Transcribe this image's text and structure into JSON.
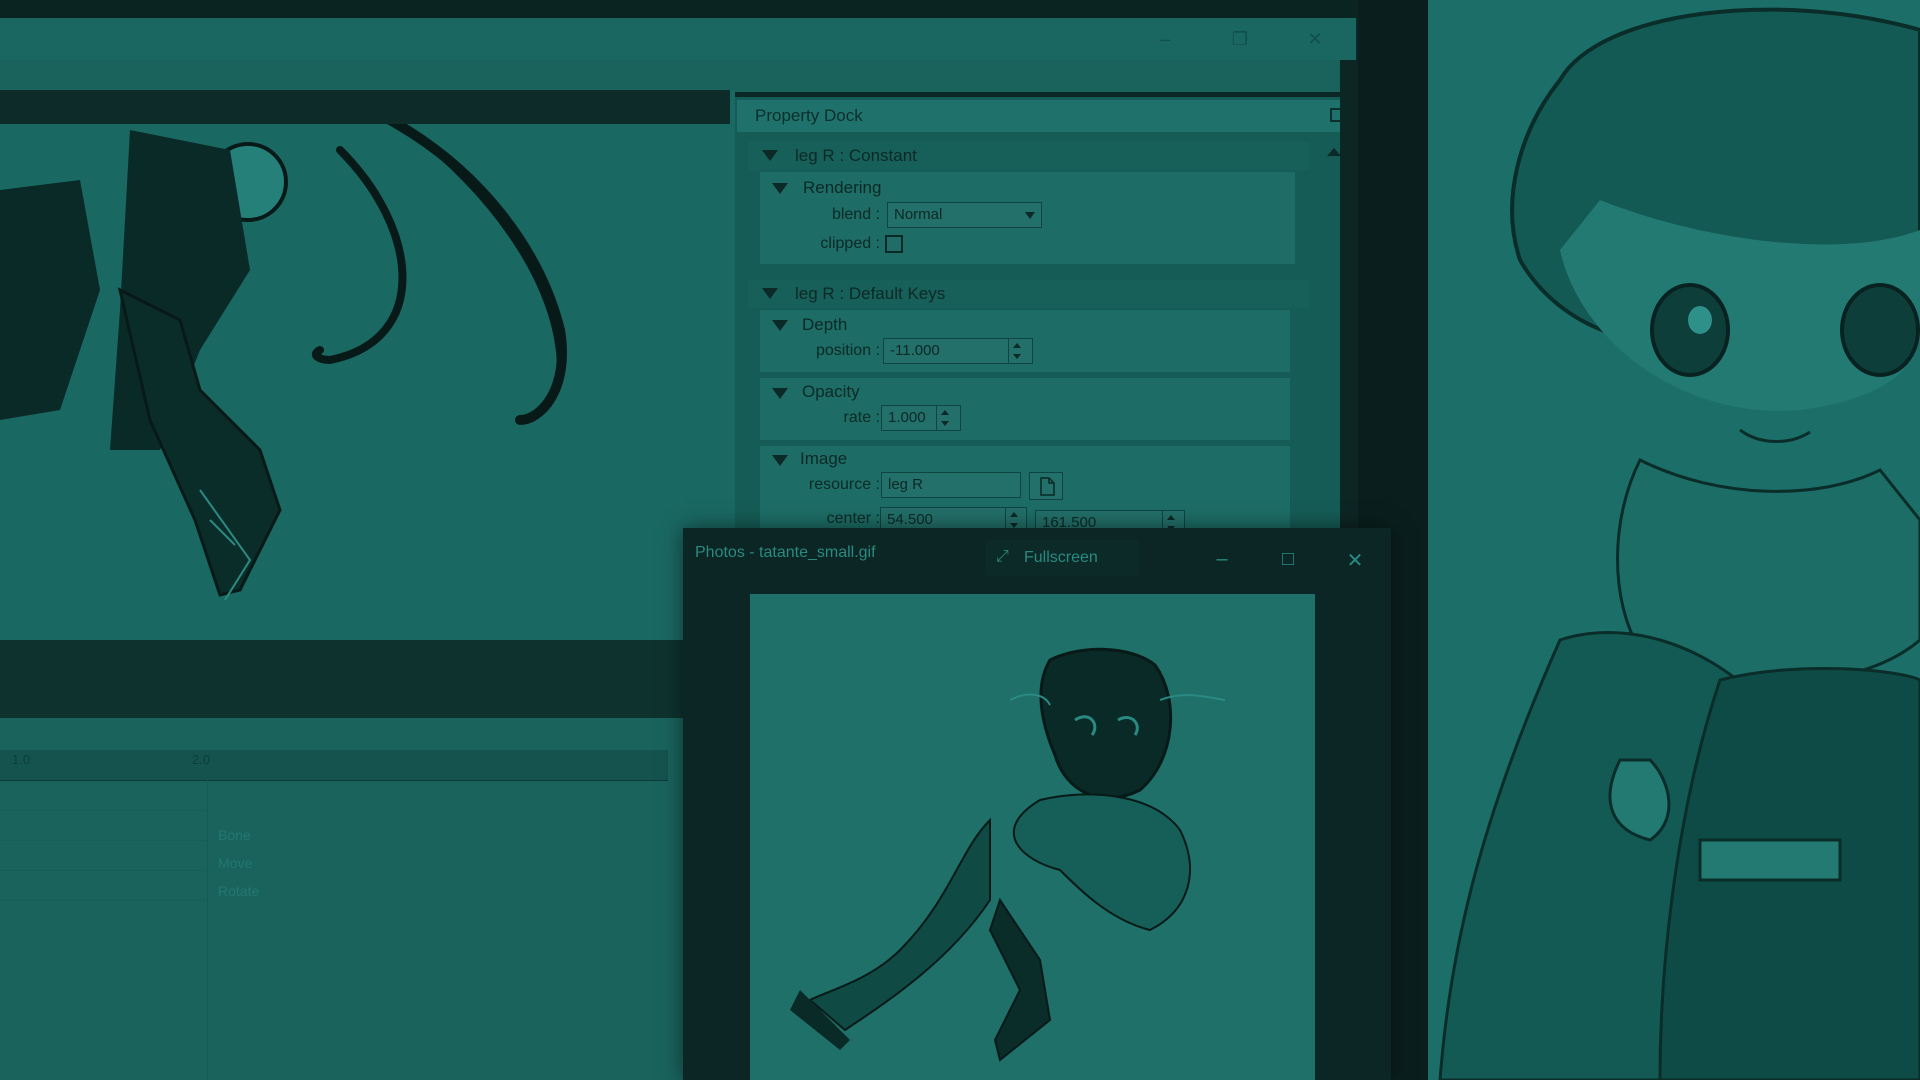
{
  "main_window": {
    "controls": {
      "minimize": "–",
      "maximize": "❐",
      "close": "✕"
    }
  },
  "property_dock": {
    "title": "Property Dock",
    "constant_group": {
      "label": "leg R : Constant",
      "rendering": {
        "label": "Rendering",
        "blend_label": "blend :",
        "blend_value": "Normal",
        "clipped_label": "clipped :"
      }
    },
    "keys_group": {
      "label": "leg R : Default Keys",
      "depth": {
        "label": "Depth",
        "position_label": "position :",
        "position_value": "-11.000"
      },
      "opacity": {
        "label": "Opacity",
        "rate_label": "rate :",
        "rate_value": "1.000"
      },
      "image": {
        "label": "Image",
        "resource_label": "resource :",
        "resource_value": "leg R",
        "center_label": "center :",
        "center_x": "54.500",
        "center_y": "161.500"
      }
    }
  },
  "timeline": {
    "ruler": [
      "1.0",
      "2.0"
    ],
    "tracks": [
      "Bone",
      "Move",
      "Rotate"
    ]
  },
  "photos_window": {
    "title": "Photos - tatante_small.gif",
    "fullscreen_label": "Fullscreen",
    "controls": {
      "minimize": "–",
      "maximize": "□",
      "close": "✕"
    }
  },
  "colors": {
    "tint": "#1a6660",
    "dark": "#0b2826"
  }
}
